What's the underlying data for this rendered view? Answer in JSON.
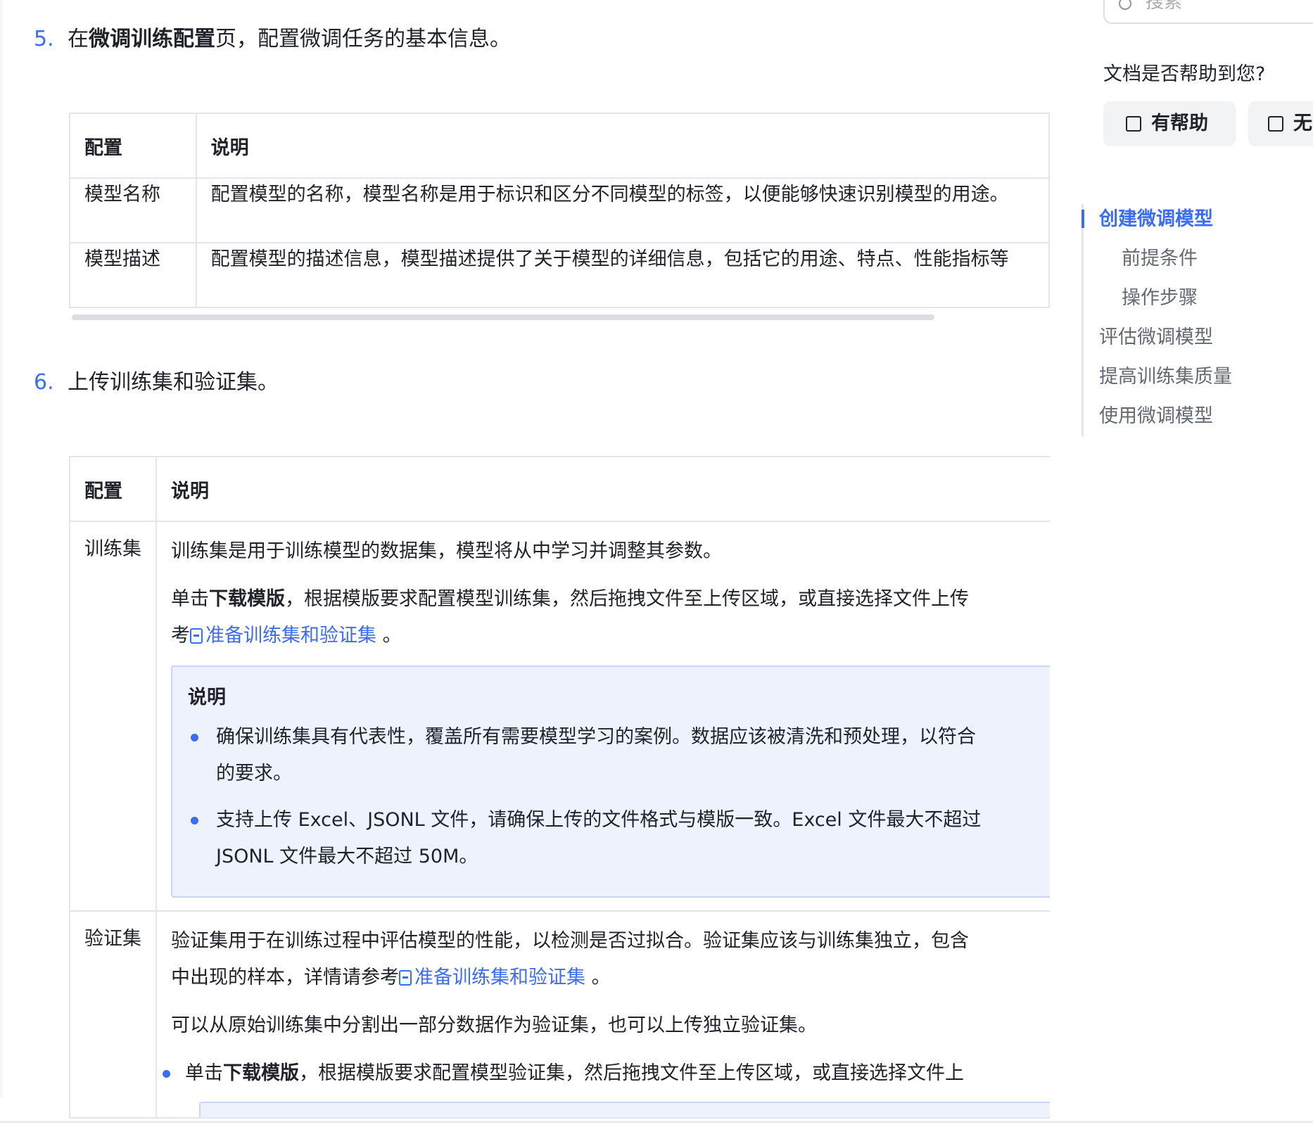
{
  "step5": {
    "num": "5.",
    "prefix": "在",
    "bold": "微调训练配置",
    "suffix": "页，配置微调任务的基本信息。"
  },
  "table1": {
    "header_config": "配置",
    "header_desc": "说明",
    "rows": [
      {
        "name": "模型名称",
        "desc": "配置模型的名称，模型名称是用于标识和区分不同模型的标签，以便能够快速识别模型的用途。"
      },
      {
        "name": "模型描述",
        "desc": "配置模型的描述信息，模型描述提供了关于模型的详细信息，包括它的用途、特点、性能指标等"
      }
    ]
  },
  "step6": {
    "num": "6.",
    "text": "上传训练集和验证集。"
  },
  "table2": {
    "header_config": "配置",
    "header_desc": "说明",
    "train": {
      "name": "训练集",
      "p1": "训练集是用于训练模型的数据集，模型将从中学习并调整其参数。",
      "p2_prefix": "单击",
      "p2_bold": "下载模版",
      "p2_suffix": "，根据模版要求配置模型训练集，然后拖拽文件至上传区域，或直接选择文件上传",
      "p3_prefix": "考",
      "p3_link": "准备训练集和验证集",
      "p3_suffix": " 。",
      "note": {
        "title": "说明",
        "b1_line1": "确保训练集具有代表性，覆盖所有需要模型学习的案例。数据应该被清洗和预处理，以符合",
        "b1_line2": "的要求。",
        "b2_line1": "支持上传 Excel、JSONL 文件，请确保上传的文件格式与模版一致。Excel 文件最大不超过",
        "b2_line2": "JSONL 文件最大不超过 50M。"
      }
    },
    "val": {
      "name": "验证集",
      "p1_line1": "验证集用于在训练过程中评估模型的性能，以检测是否过拟合。验证集应该与训练集独立，包含",
      "p1_line2_prefix": "中出现的样本，详情请参考",
      "p1_link": "准备训练集和验证集",
      "p1_suffix": " 。",
      "p2": "可以从原始训练集中分割出一部分数据作为验证集，也可以上传独立验证集。",
      "b1_prefix": "单击",
      "b1_bold": "下载模版",
      "b1_suffix": "，根据模版要求配置模型验证集，然后拖拽文件至上传区域，或直接选择文件上"
    }
  },
  "sidebar": {
    "search_placeholder": "搜索",
    "help_question": "文档是否帮助到您?",
    "helpful_label": "有帮助",
    "unhelpful_label": "无帮助",
    "toc": [
      {
        "label": "创建微调模型",
        "active": true,
        "level": 1
      },
      {
        "label": "前提条件",
        "active": false,
        "level": 2
      },
      {
        "label": "操作步骤",
        "active": false,
        "level": 2
      },
      {
        "label": "评估微调模型",
        "active": false,
        "level": 1
      },
      {
        "label": "提高训练集质量",
        "active": false,
        "level": 1
      },
      {
        "label": "使用微调模型",
        "active": false,
        "level": 1
      }
    ]
  },
  "colors": {
    "accent": "#3b6cf6",
    "note_bg": "#eef2fd",
    "note_border": "#c9d4f7",
    "table_border": "#e5e6eb"
  }
}
